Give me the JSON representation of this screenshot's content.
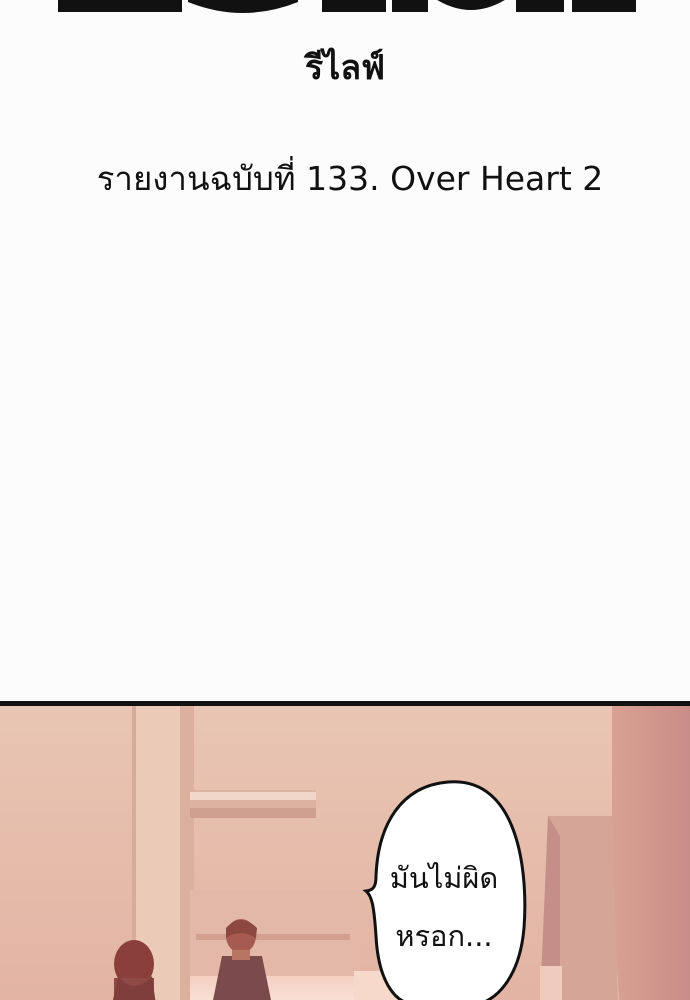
{
  "header": {
    "subtitle": "รีไลฟ์",
    "chapter_title": "รายงานฉบับที่ 133. Over Heart 2"
  },
  "panel": {
    "speech_bubble": {
      "line1": "มันไม่ผิด",
      "line2": "หรอก..."
    }
  },
  "colors": {
    "page_background": "#fcfcfc",
    "text": "#111111",
    "panel_wall": "#e7c1ae",
    "panel_shadow": "#c98f88"
  }
}
